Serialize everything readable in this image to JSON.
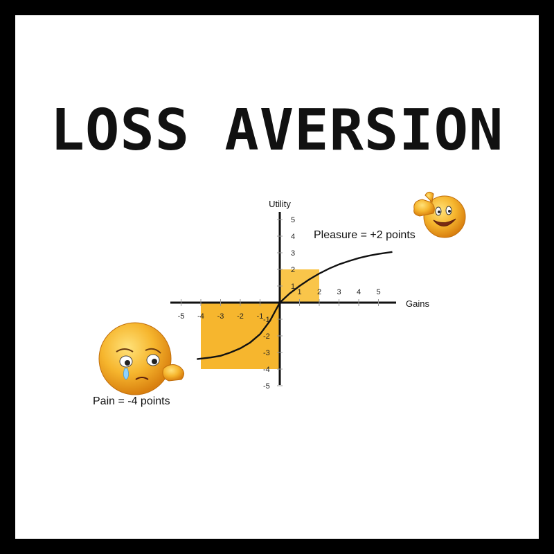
{
  "title": "LOSS AVERSION",
  "colors": {
    "highlight": "#f6b62e",
    "highlight_light": "#f9c54a",
    "axis": "#111111",
    "emoji_face": "#f4a21a",
    "emoji_highlight": "#ffe27a",
    "border": "#000000"
  },
  "icons": {
    "happy": "thumbs-up-smiley-icon",
    "sad": "crying-smiley-icon"
  },
  "chart_data": {
    "type": "line",
    "xlabel": "Gains",
    "ylabel": "Utility",
    "xlim": [
      -5,
      5
    ],
    "ylim": [
      -5,
      5
    ],
    "x_ticks": [
      -5,
      -4,
      -3,
      -2,
      -1,
      1,
      2,
      3,
      4,
      5
    ],
    "y_ticks": [
      -5,
      -4,
      -3,
      -2,
      -1,
      1,
      2,
      3,
      4,
      5
    ],
    "tick_labels": {
      "x": [
        "-5",
        "-4",
        "-3",
        "-2",
        "-1",
        "1",
        "2",
        "3",
        "4",
        "5"
      ],
      "y": [
        "-5",
        "-4",
        "-3",
        "-2",
        "-1",
        "1",
        "2",
        "3",
        "4",
        "5"
      ]
    },
    "series": [
      {
        "x": [
          -4.2,
          -3.5,
          -3,
          -2.5,
          -2,
          -1.5,
          -1,
          -0.5,
          0,
          0.5,
          1,
          1.5,
          2,
          2.5,
          3,
          3.5,
          4,
          4.5,
          5,
          5.7
        ],
        "y": [
          -3.4,
          -3.3,
          -3.2,
          -3.0,
          -2.75,
          -2.4,
          -1.9,
          -1.1,
          0,
          0.55,
          1.0,
          1.4,
          1.75,
          2.05,
          2.3,
          2.5,
          2.68,
          2.82,
          2.93,
          3.05
        ]
      }
    ],
    "highlight_boxes": [
      {
        "x": [
          0,
          2
        ],
        "y": [
          0,
          2
        ]
      },
      {
        "x": [
          -4,
          0
        ],
        "y": [
          -4,
          0
        ]
      }
    ],
    "annotations": {
      "pleasure": "Pleasure = +2 points",
      "pain": "Pain = -4 points"
    },
    "grid": false
  }
}
